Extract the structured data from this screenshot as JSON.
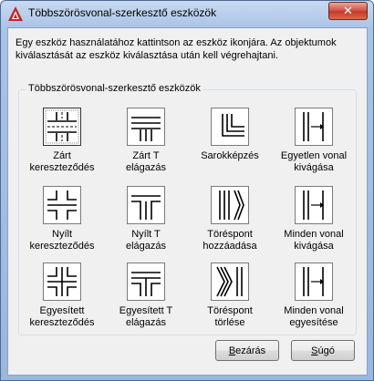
{
  "window": {
    "title": "Többszörösvonal-szerkesztő eszközök",
    "close_symbol": "✕"
  },
  "instructions": "Egy eszköz használatához kattintson az eszköz ikonjára. Az objektumok kiválasztását az eszköz kiválasztása után kell végrehajtani.",
  "group": {
    "title": "Többszörösvonal-szerkesztő eszközök",
    "tools": [
      {
        "label1": "Zárt",
        "label2": "kereszteződés",
        "icon": "closed-cross-icon"
      },
      {
        "label1": "Zárt T",
        "label2": "elágazás",
        "icon": "closed-tee-icon"
      },
      {
        "label1": "Sarokképzés",
        "label2": "",
        "icon": "corner-joint-icon"
      },
      {
        "label1": "Egyetlen vonal",
        "label2": "kivágása",
        "icon": "cut-single-icon"
      },
      {
        "label1": "Nyílt",
        "label2": "kereszteződés",
        "icon": "open-cross-icon"
      },
      {
        "label1": "Nyílt T",
        "label2": "elágazás",
        "icon": "open-tee-icon"
      },
      {
        "label1": "Töréspont",
        "label2": "hozzáadása",
        "icon": "add-vertex-icon"
      },
      {
        "label1": "Minden vonal",
        "label2": "kivágása",
        "icon": "cut-all-icon"
      },
      {
        "label1": "Egyesített",
        "label2": "kereszteződés",
        "icon": "merged-cross-icon"
      },
      {
        "label1": "Egyesített T",
        "label2": "elágazás",
        "icon": "merged-tee-icon"
      },
      {
        "label1": "Töréspont",
        "label2": "törlése",
        "icon": "delete-vertex-icon"
      },
      {
        "label1": "Minden vonal",
        "label2": "egyesítése",
        "icon": "weld-all-icon"
      }
    ]
  },
  "buttons": {
    "close": {
      "mnemonic": "B",
      "rest": "ezárás"
    },
    "help": {
      "mnemonic": "S",
      "rest": "úgó"
    }
  },
  "colors": {
    "accent_app_icon": "#c8202a"
  }
}
